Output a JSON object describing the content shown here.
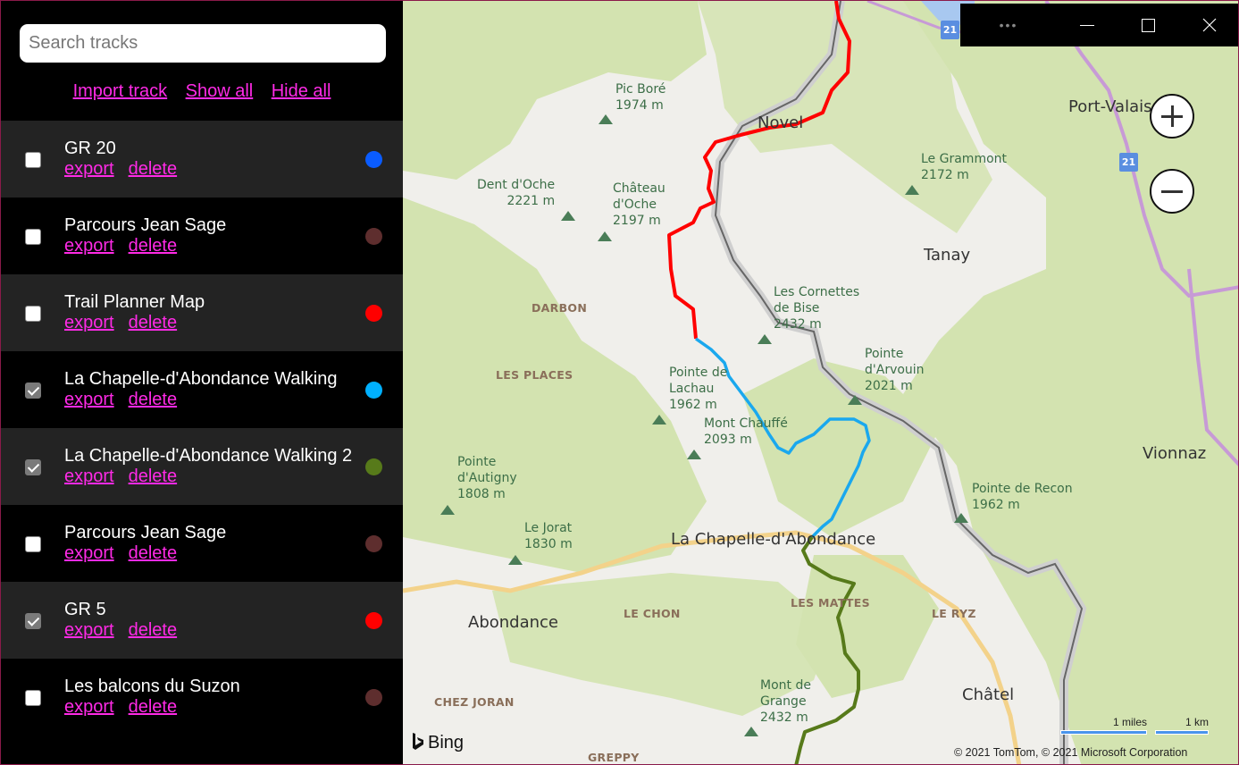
{
  "sidebar": {
    "search_placeholder": "Search tracks",
    "search_value": "",
    "actions": {
      "import": "Import track",
      "show_all": "Show all",
      "hide_all": "Hide all"
    },
    "tracks": [
      {
        "name": "GR 20",
        "checked": false,
        "color": "#0a5cff",
        "export": "export",
        "delete": "delete"
      },
      {
        "name": "Parcours Jean Sage",
        "checked": false,
        "color": "#5e2e2e",
        "export": "export",
        "delete": "delete"
      },
      {
        "name": "Trail Planner Map",
        "checked": false,
        "color": "#ff0000",
        "export": "export",
        "delete": "delete"
      },
      {
        "name": "La Chapelle-d'Abondance Walking",
        "checked": true,
        "color": "#00b0ff",
        "export": "export",
        "delete": "delete"
      },
      {
        "name": "La Chapelle-d'Abondance Walking 2",
        "checked": true,
        "color": "#577a1a",
        "export": "export",
        "delete": "delete"
      },
      {
        "name": "Parcours Jean Sage",
        "checked": false,
        "color": "#5e2e2e",
        "export": "export",
        "delete": "delete"
      },
      {
        "name": "GR 5",
        "checked": true,
        "color": "#ff0000",
        "export": "export",
        "delete": "delete"
      },
      {
        "name": "Les balcons du Suzon",
        "checked": false,
        "color": "#5e2e2e",
        "export": "export",
        "delete": "delete"
      }
    ]
  },
  "window_controls": {
    "more": "more-icon",
    "minimize": "minimize-icon",
    "maximize": "maximize-icon",
    "close": "close-icon"
  },
  "map": {
    "towns": [
      "Novel",
      "Port-Valais",
      "Tanay",
      "La Chapelle-d'Abondance",
      "Abondance",
      "Châtel",
      "Vionnaz"
    ],
    "peaks": [
      {
        "name": "Pic Boré",
        "elev": "1974 m"
      },
      {
        "name": "Dent d'Oche",
        "elev": "2221 m"
      },
      {
        "name": "Château d'Oche",
        "elev": "2197 m"
      },
      {
        "name": "Le Grammont",
        "elev": "2172 m"
      },
      {
        "name": "Les Cornettes de Bise",
        "elev": "2432 m"
      },
      {
        "name": "Pointe d'Arvouin",
        "elev": "2021 m"
      },
      {
        "name": "Pointe de Lachau",
        "elev": "1962 m"
      },
      {
        "name": "Mont Chauffé",
        "elev": "2093 m"
      },
      {
        "name": "Pointe d'Autigny",
        "elev": "1808 m"
      },
      {
        "name": "Le Jorat",
        "elev": "1830 m"
      },
      {
        "name": "Pointe de Recon",
        "elev": "1962 m"
      },
      {
        "name": "Mont de Grange",
        "elev": "2432 m"
      }
    ],
    "hamlets": [
      "DARBON",
      "LES PLACES",
      "LE CHON",
      "LES MATTES",
      "LE RYZ",
      "CHEZ JORAN",
      "GREPPY"
    ],
    "road_shield": "21",
    "brand": "Bing",
    "scale_miles": "1 miles",
    "scale_km": "1 km",
    "copyright": "© 2021 TomTom, © 2021 Microsoft Corporation",
    "track_colors": {
      "gr5": "#ff0000",
      "chapelle1": "#1aa8ee",
      "chapelle2": "#577a1a"
    }
  }
}
